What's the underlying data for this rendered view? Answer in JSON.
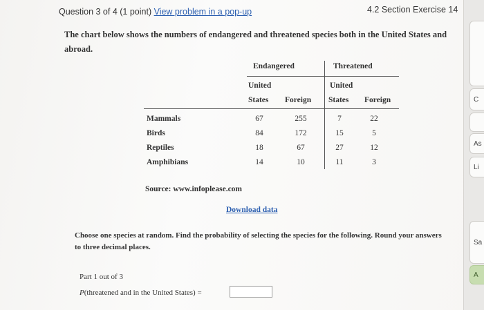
{
  "header": {
    "question_label": "Question 3 of 4 (1 point)",
    "popup_link": "View problem in a pop-up",
    "section": "4.2 Section Exercise 14"
  },
  "intro": "The chart below shows the numbers of endangered and threatened species both in the United States and abroad.",
  "table": {
    "group_headers": [
      "Endangered",
      "Threatened"
    ],
    "subheaders_line1": [
      "United",
      "",
      "United",
      ""
    ],
    "subheaders_line2": [
      "States",
      "Foreign",
      "States",
      "Foreign"
    ],
    "rows": [
      {
        "label": "Mammals",
        "values": [
          "67",
          "255",
          "7",
          "22"
        ]
      },
      {
        "label": "Birds",
        "values": [
          "84",
          "172",
          "15",
          "5"
        ]
      },
      {
        "label": "Reptiles",
        "values": [
          "18",
          "67",
          "27",
          "12"
        ]
      },
      {
        "label": "Amphibians",
        "values": [
          "14",
          "10",
          "11",
          "3"
        ]
      }
    ]
  },
  "source": "Source: www.infoplease.com",
  "download_link": "Download data",
  "instructions": "Choose one species at random. Find the probability of selecting the species for the following. Round your answers to three decimal places.",
  "part_label": "Part 1 out of 3",
  "probability_prefix": "P",
  "probability_text": "(threatened and in the United States) =",
  "answer_value": "",
  "sidebar": {
    "buttons": [
      "",
      "C",
      "",
      "As",
      "Li",
      "Sa",
      "A"
    ]
  },
  "colors": {
    "link": "#2c5fb0",
    "accent_green": "#c7ddb0"
  }
}
